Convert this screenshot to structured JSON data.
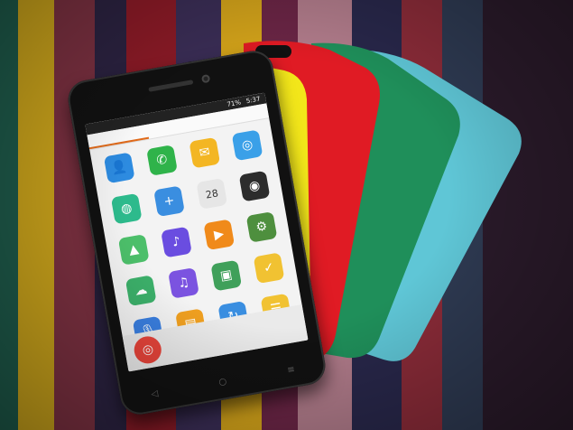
{
  "scene": {
    "description_subject": "phone-with-colored-back-covers",
    "stripe_colors": [
      "#1e5a4a",
      "#c9a21b",
      "#7a3040",
      "#2b2240",
      "#8a1a26",
      "#3a2d55",
      "#d2a21a",
      "#6a2545",
      "#b07b8a",
      "#28274a",
      "#8a2b38",
      "#2e3a52"
    ]
  },
  "covers": [
    {
      "name": "cyan-cover",
      "color": "#5fc6d6"
    },
    {
      "name": "green-cover",
      "color": "#1f8f5a"
    },
    {
      "name": "red-cover",
      "color": "#e01b24"
    },
    {
      "name": "yellow-cover",
      "color": "#f2e61a"
    }
  ],
  "phone": {
    "status": {
      "battery": "71%",
      "time": "5:37"
    },
    "apps": [
      {
        "icon": "contacts-icon",
        "color": "#2d8be0",
        "glyph": "👤"
      },
      {
        "icon": "phone-icon",
        "color": "#2fb34a",
        "glyph": "✆"
      },
      {
        "icon": "messaging-icon",
        "color": "#f3b623",
        "glyph": "✉"
      },
      {
        "icon": "camera-app-icon",
        "color": "#3aa0e8",
        "glyph": "◎"
      },
      {
        "icon": "browser-icon",
        "color": "#2dba8c",
        "glyph": "◍"
      },
      {
        "icon": "tools-icon",
        "color": "#3a8ee0",
        "glyph": "+"
      },
      {
        "icon": "calendar-icon",
        "color": "#e6e6e6",
        "glyph": "28"
      },
      {
        "icon": "camera-icon",
        "color": "#2c2c2c",
        "glyph": "◉"
      },
      {
        "icon": "gallery-icon",
        "color": "#4cbf6a",
        "glyph": "▲"
      },
      {
        "icon": "music-icon",
        "color": "#6a4de0",
        "glyph": "♪"
      },
      {
        "icon": "video-player-icon",
        "color": "#f08a1a",
        "glyph": "▶"
      },
      {
        "icon": "settings-icon",
        "color": "#4e8f3e",
        "glyph": "⚙"
      },
      {
        "icon": "gallery2-icon",
        "color": "#3cb06a",
        "glyph": "☁"
      },
      {
        "icon": "music2-icon",
        "color": "#7b53e0",
        "glyph": "♫"
      },
      {
        "icon": "store-icon",
        "color": "#3fa05a",
        "glyph": "▣"
      },
      {
        "icon": "tasks-icon",
        "color": "#f1c232",
        "glyph": "✓"
      },
      {
        "icon": "recorder-icon",
        "color": "#3a7fe0",
        "glyph": "🎙"
      },
      {
        "icon": "file-manager-icon",
        "color": "#f0a020",
        "glyph": "▤"
      },
      {
        "icon": "backup-icon",
        "color": "#3a8ee0",
        "glyph": "↻"
      },
      {
        "icon": "notes-icon",
        "color": "#f1c232",
        "glyph": "☰"
      }
    ],
    "dock": [
      {
        "icon": "chrome-icon",
        "color": "#e7443a",
        "glyph": "◎"
      }
    ]
  }
}
